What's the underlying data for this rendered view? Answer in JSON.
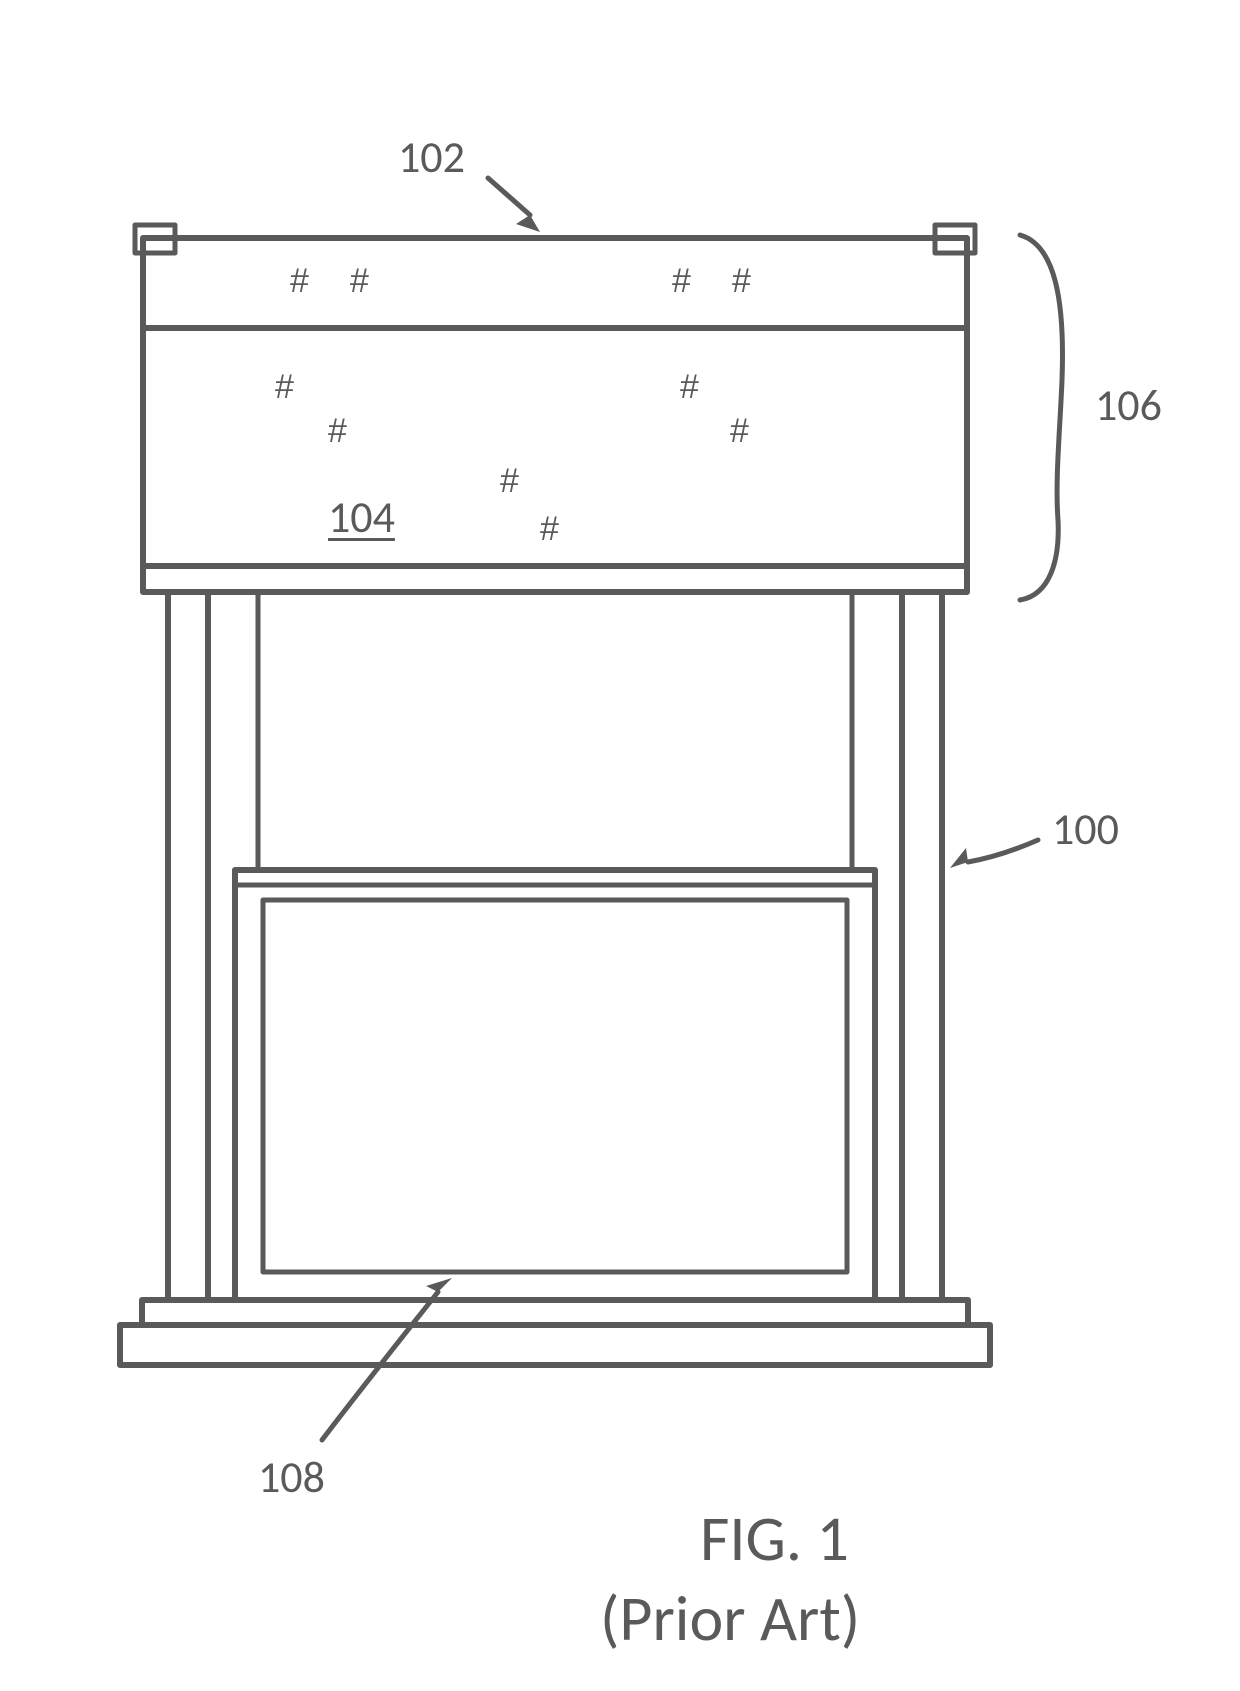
{
  "figure": {
    "title_line1": "FIG. 1",
    "title_line2": "(Prior Art)"
  },
  "refs": {
    "r100": "100",
    "r102": "102",
    "r104": "104",
    "r106": "106",
    "r108": "108"
  },
  "hash": "#"
}
